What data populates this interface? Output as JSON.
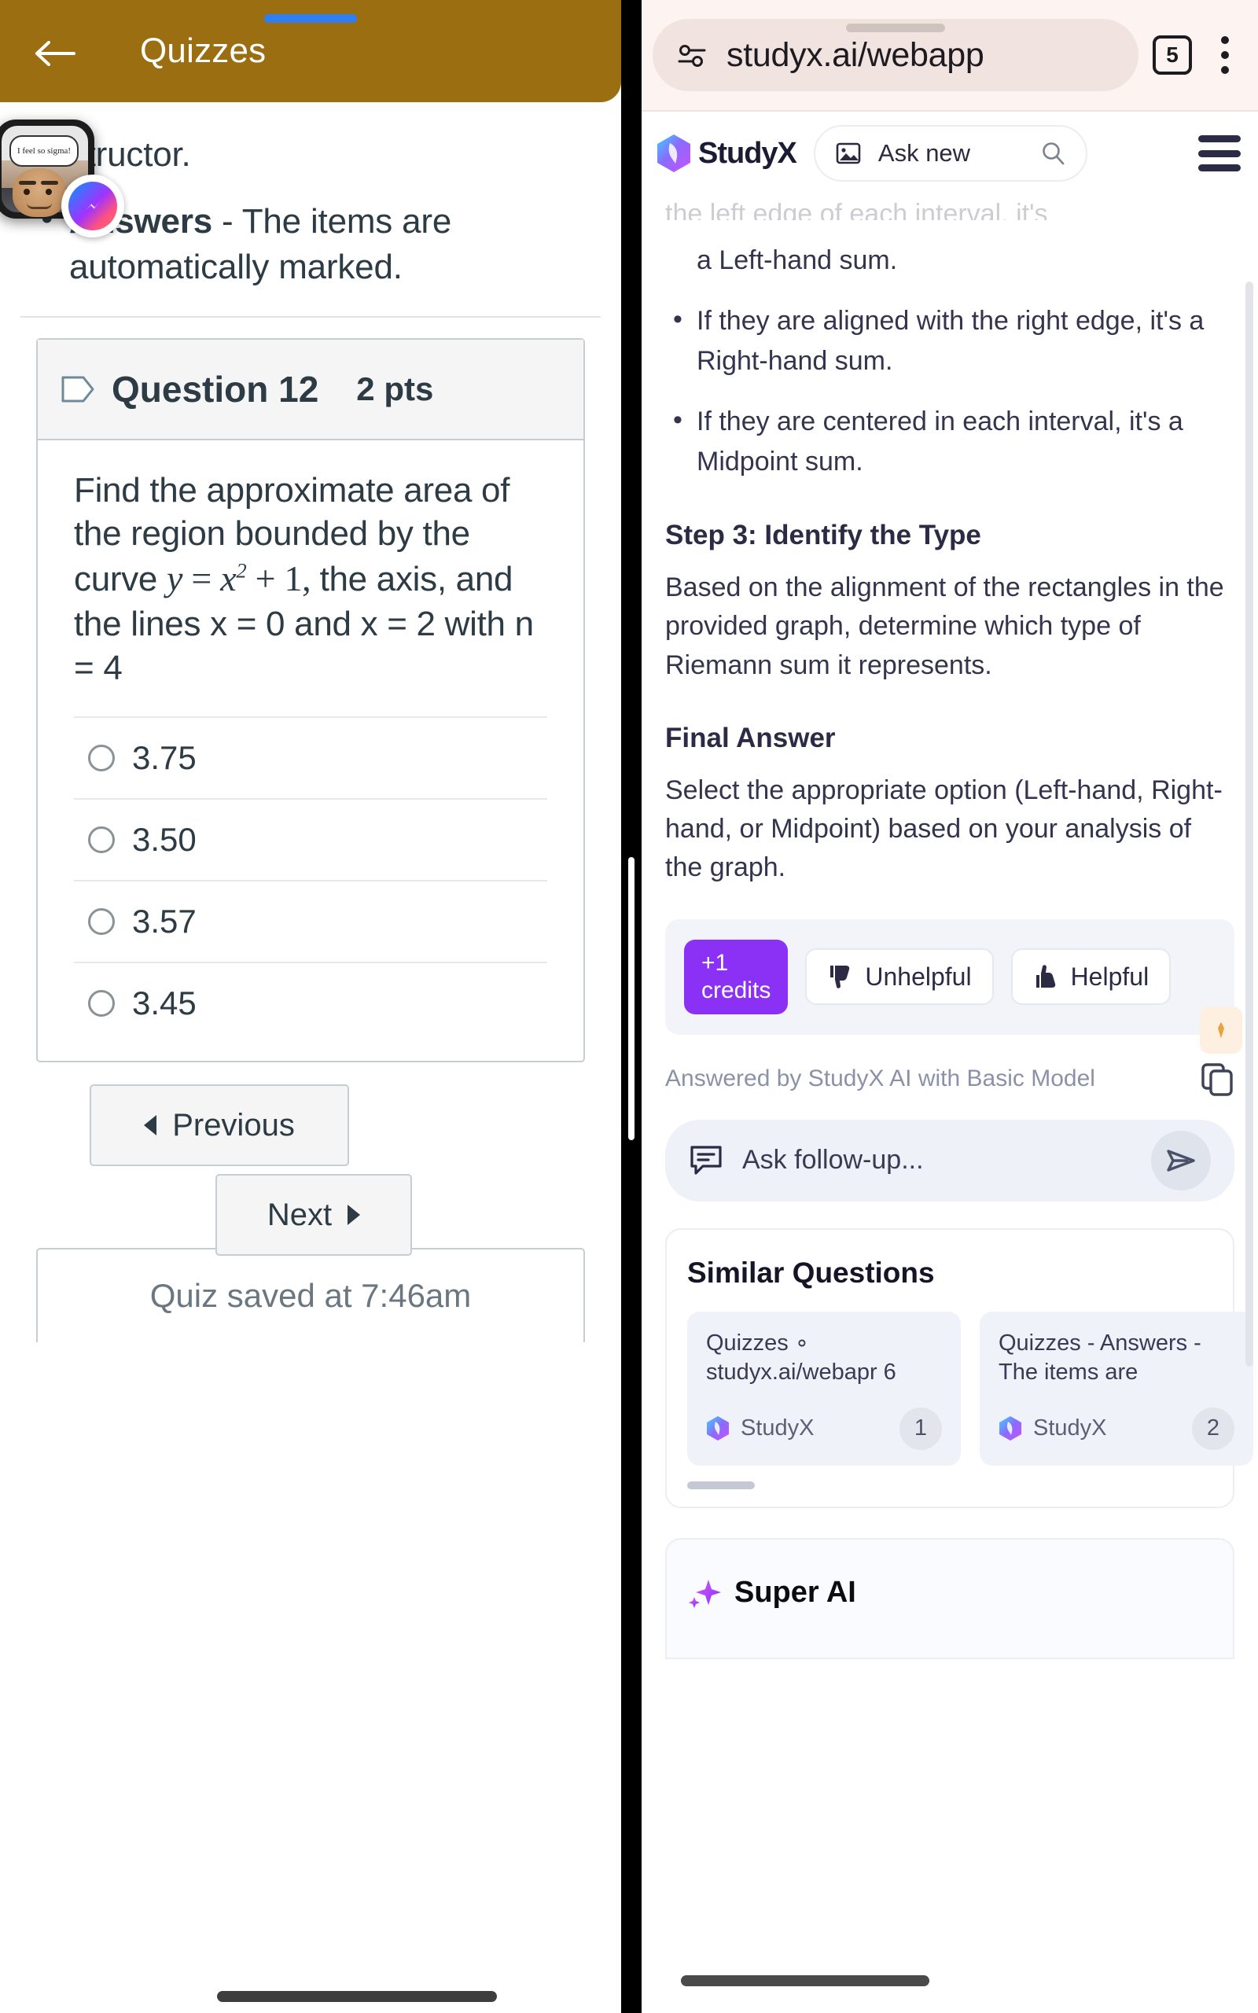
{
  "left": {
    "appbar": {
      "title": "Quizzes",
      "back_icon": "back-arrow-icon"
    },
    "intro": {
      "line1": "instructor.",
      "bullet_bold": "Answers",
      "bullet_rest": " - The items are automatically marked."
    },
    "question": {
      "number_label": "Question 12",
      "points_label": "2 pts",
      "text_before_math": "Find the approximate area of the region bounded by the curve",
      "math": {
        "lhs": "y",
        "eq": "=",
        "var": "x",
        "exp": "2",
        "plus": "+",
        "const": "1",
        "comma": ","
      },
      "text_after_math": "the axis, and the lines x = 0 and x = 2 with n = 4",
      "options": [
        {
          "label": "3.75",
          "selected": false
        },
        {
          "label": "3.50",
          "selected": false
        },
        {
          "label": "3.57",
          "selected": false
        },
        {
          "label": "3.45",
          "selected": false
        }
      ]
    },
    "nav": {
      "previous_label": "Previous",
      "next_label": "Next"
    },
    "saved_status": "Quiz saved at 7:46am",
    "chathead": {
      "bubble_text": "I feel so sigma!",
      "badge_icon": "messenger-icon"
    }
  },
  "right": {
    "browser": {
      "url": "studyx.ai/webapp",
      "tab_count": "5",
      "site_settings_icon": "tune-icon",
      "menu_icon": "kebab-menu-icon"
    },
    "app_header": {
      "brand": "StudyX",
      "ask_new_label": "Ask new",
      "image_icon": "image-icon",
      "search_icon": "search-icon",
      "menu_icon": "hamburger-icon"
    },
    "answer": {
      "clipped_line": "the left edge of each interval, it's",
      "clipped_cont": "a Left-hand sum.",
      "bullets": [
        "If they are aligned with the right edge, it's a Right-hand sum.",
        "If they are centered in each interval, it's a Midpoint sum."
      ],
      "step3_heading": "Step 3: Identify the Type",
      "step3_body": "Based on the alignment of the rectangles in the provided graph, determine which type of Riemann sum it represents.",
      "final_heading": "Final Answer",
      "final_body": "Select the appropriate option (Left-hand, Right-hand, or Midpoint) based on your analysis of the graph.",
      "feedback": {
        "credits_line1": "+1",
        "credits_line2": "credits",
        "unhelpful_label": "Unhelpful",
        "helpful_label": "Helpful",
        "thumbs_down_icon": "thumbs-down-icon",
        "thumbs_up_icon": "thumbs-up-icon"
      },
      "attribution": "Answered by StudyX AI with Basic Model",
      "copy_icon": "copy-icon",
      "followup_placeholder": "Ask follow-up...",
      "chat_icon": "chat-bubble-icon",
      "send_icon": "send-icon"
    },
    "similar": {
      "title": "Similar Questions",
      "cards": [
        {
          "text": "Quizzes ∘ studyx.ai/webapr 6",
          "brand": "StudyX",
          "count": "1"
        },
        {
          "text": "Quizzes - Answers - The items are",
          "brand": "StudyX",
          "count": "2"
        }
      ]
    },
    "super_ai": {
      "title": "Super AI",
      "icon": "sparkle-icon"
    }
  },
  "colors": {
    "appbar_gold": "#9a6e11",
    "credits_purple": "#8b30f5",
    "canvas_text": "#2d3b45",
    "studyx_text": "#34344e",
    "status_blue": "#2f7ff0"
  }
}
